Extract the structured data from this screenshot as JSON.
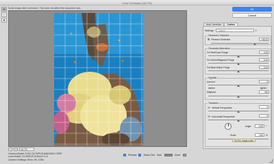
{
  "window": {
    "title": "Lens Correction (16.7%)"
  },
  "hint": "Scale image after correction. This does not affect the document size.",
  "canvas": {
    "zoom_value": "16.7%",
    "zoom_minus": "−",
    "zoom_plus": "+",
    "photo_colors": {
      "water": "#1a7fc0",
      "coral_yellow": "#e8dc8e",
      "coral_pink": "#d47ca0",
      "reef": "#6b5b4b"
    }
  },
  "camera": {
    "model": "Camera Model: E-M1 OLYMPUS IMAGING CORP.",
    "lens": "Lens Model: OLYMPUS M.8mm F1.8",
    "settings": "Camera Settings: 8mm, f/5, 0.25s"
  },
  "bottom": {
    "preview_label": "Preview",
    "show_grid_label": "Show Grid",
    "size_label": "Size:",
    "size_value": "",
    "color_label": "Color:"
  },
  "buttons": {
    "ok": "OK",
    "cancel": "Cancel"
  },
  "tabs": [
    {
      "label": "Auto Correction",
      "active": false
    },
    {
      "label": "Custom",
      "active": true
    }
  ],
  "settings": {
    "label": "Settings:",
    "value": "Custom"
  },
  "geometric": {
    "title": "Geometric Distortion",
    "remove_label": "Remove Distortion",
    "remove_value": "+46.00"
  },
  "chromatic": {
    "title": "Chromatic Aberration",
    "rows": [
      {
        "label": "Fix Red/Cyan Fringe",
        "value": "0.00"
      },
      {
        "label": "Fix Green/Magenta Fringe",
        "value": "0.00"
      },
      {
        "label": "Fix Blue/Yellow Fringe",
        "value": "0.00"
      }
    ]
  },
  "vignette": {
    "title": "Vignette",
    "amount_label": "Amount",
    "amount_value": "0",
    "darken_label": "darken",
    "lighten_label": "lighten",
    "midpoint_label": "Midpoint",
    "midpoint_value": "+50"
  },
  "transform": {
    "title": "Transform",
    "vertical_label": "Vertical Perspective",
    "vertical_value": "0",
    "horizontal_label": "Horizontal Perspective",
    "horizontal_value": "0",
    "angle_label": "Angle:",
    "angle_value": "0.00",
    "angle_unit": "°",
    "scale_label": "Scale",
    "scale_value": "100",
    "scale_unit": "%"
  },
  "tooltip": "Set the image scale"
}
